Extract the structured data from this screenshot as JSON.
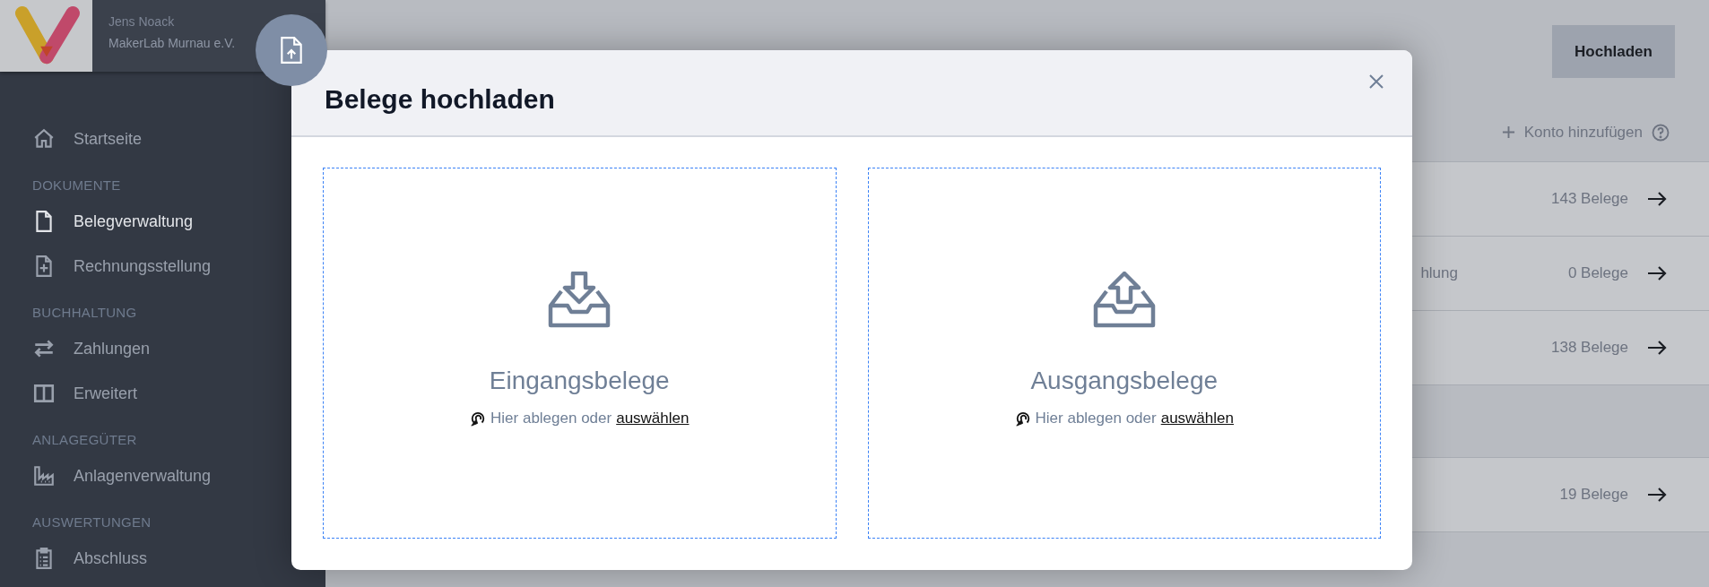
{
  "sidebar": {
    "user": "Jens Noack",
    "organization": "MakerLab Murnau e.V.",
    "sections": [
      {
        "items": [
          {
            "label": "Startseite",
            "selected": false
          }
        ]
      },
      {
        "heading": "DOKUMENTE",
        "items": [
          {
            "label": "Belegverwaltung",
            "selected": true
          },
          {
            "label": "Rechnungsstellung",
            "selected": false
          }
        ]
      },
      {
        "heading": "BUCHHALTUNG",
        "items": [
          {
            "label": "Zahlungen",
            "selected": false
          },
          {
            "label": "Erweitert",
            "selected": false
          }
        ]
      },
      {
        "heading": "ANLAGEGÜTER",
        "items": [
          {
            "label": "Anlagenverwaltung",
            "selected": false
          }
        ]
      },
      {
        "heading": "AUSWERTUNGEN",
        "items": [
          {
            "label": "Abschluss",
            "selected": false
          }
        ]
      }
    ]
  },
  "main": {
    "upload_button": "Hochladen",
    "add_account": "Konto hinzufügen",
    "rows": [
      {
        "kind": "account",
        "count": "143 Belege"
      },
      {
        "kind": "account",
        "label": "hlung",
        "count": "0 Belege"
      },
      {
        "kind": "account",
        "count": "138 Belege"
      },
      {
        "kind": "blank"
      },
      {
        "kind": "account",
        "count": "19 Belege"
      }
    ]
  },
  "modal": {
    "title": "Belege hochladen",
    "zones": [
      {
        "title": "Eingangsbelege",
        "hint": "Hier ablegen oder",
        "link": "auswählen"
      },
      {
        "title": "Ausgangsbelege",
        "hint": "Hier ablegen oder",
        "link": "auswählen"
      }
    ]
  }
}
